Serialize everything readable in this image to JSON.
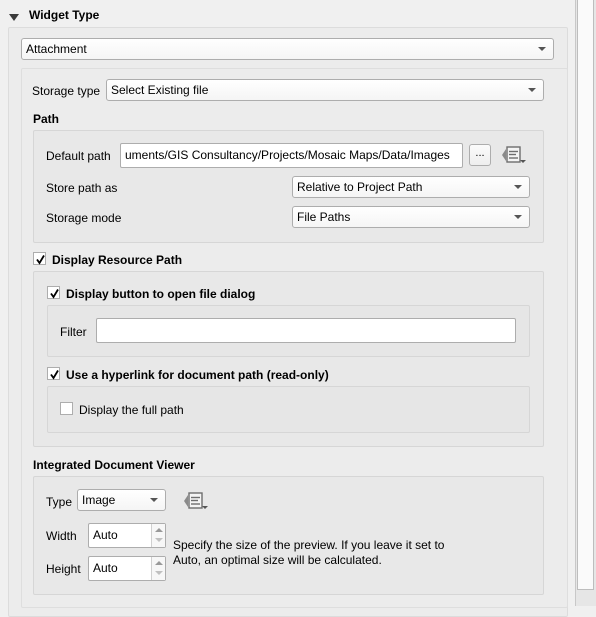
{
  "header": {
    "title": "Widget Type",
    "expanded": true
  },
  "widget_type": {
    "selected": "Attachment"
  },
  "storage_type": {
    "label": "Storage type",
    "selected": "Select Existing file"
  },
  "path": {
    "title": "Path",
    "default_path_label": "Default path",
    "default_path_value": "uments/GIS Consultancy/Projects/Mosaic Maps/Data/Images",
    "browse_button": "...",
    "store_path_as_label": "Store path as",
    "store_path_as_selected": "Relative to Project Path",
    "storage_mode_label": "Storage mode",
    "storage_mode_selected": "File Paths"
  },
  "display_resource_path": {
    "label": "Display Resource Path",
    "checked": true,
    "open_file_dialog": {
      "label": "Display button to open file dialog",
      "checked": true,
      "filter_label": "Filter",
      "filter_value": ""
    },
    "hyperlink": {
      "label": "Use a hyperlink for document path (read-only)",
      "checked": true,
      "full_path_label": "Display the full path",
      "full_path_checked": false
    }
  },
  "document_viewer": {
    "title": "Integrated Document Viewer",
    "type_label": "Type",
    "type_selected": "Image",
    "width_label": "Width",
    "width_value": "Auto",
    "height_label": "Height",
    "height_value": "Auto",
    "help_text": "Specify the size of the preview. If you leave it set to Auto, an optimal size will be calculated."
  },
  "icons": {
    "header_toggle": "triangle-down-icon",
    "data_defined": "data-defined-override-icon",
    "check": "checkmark-icon"
  }
}
